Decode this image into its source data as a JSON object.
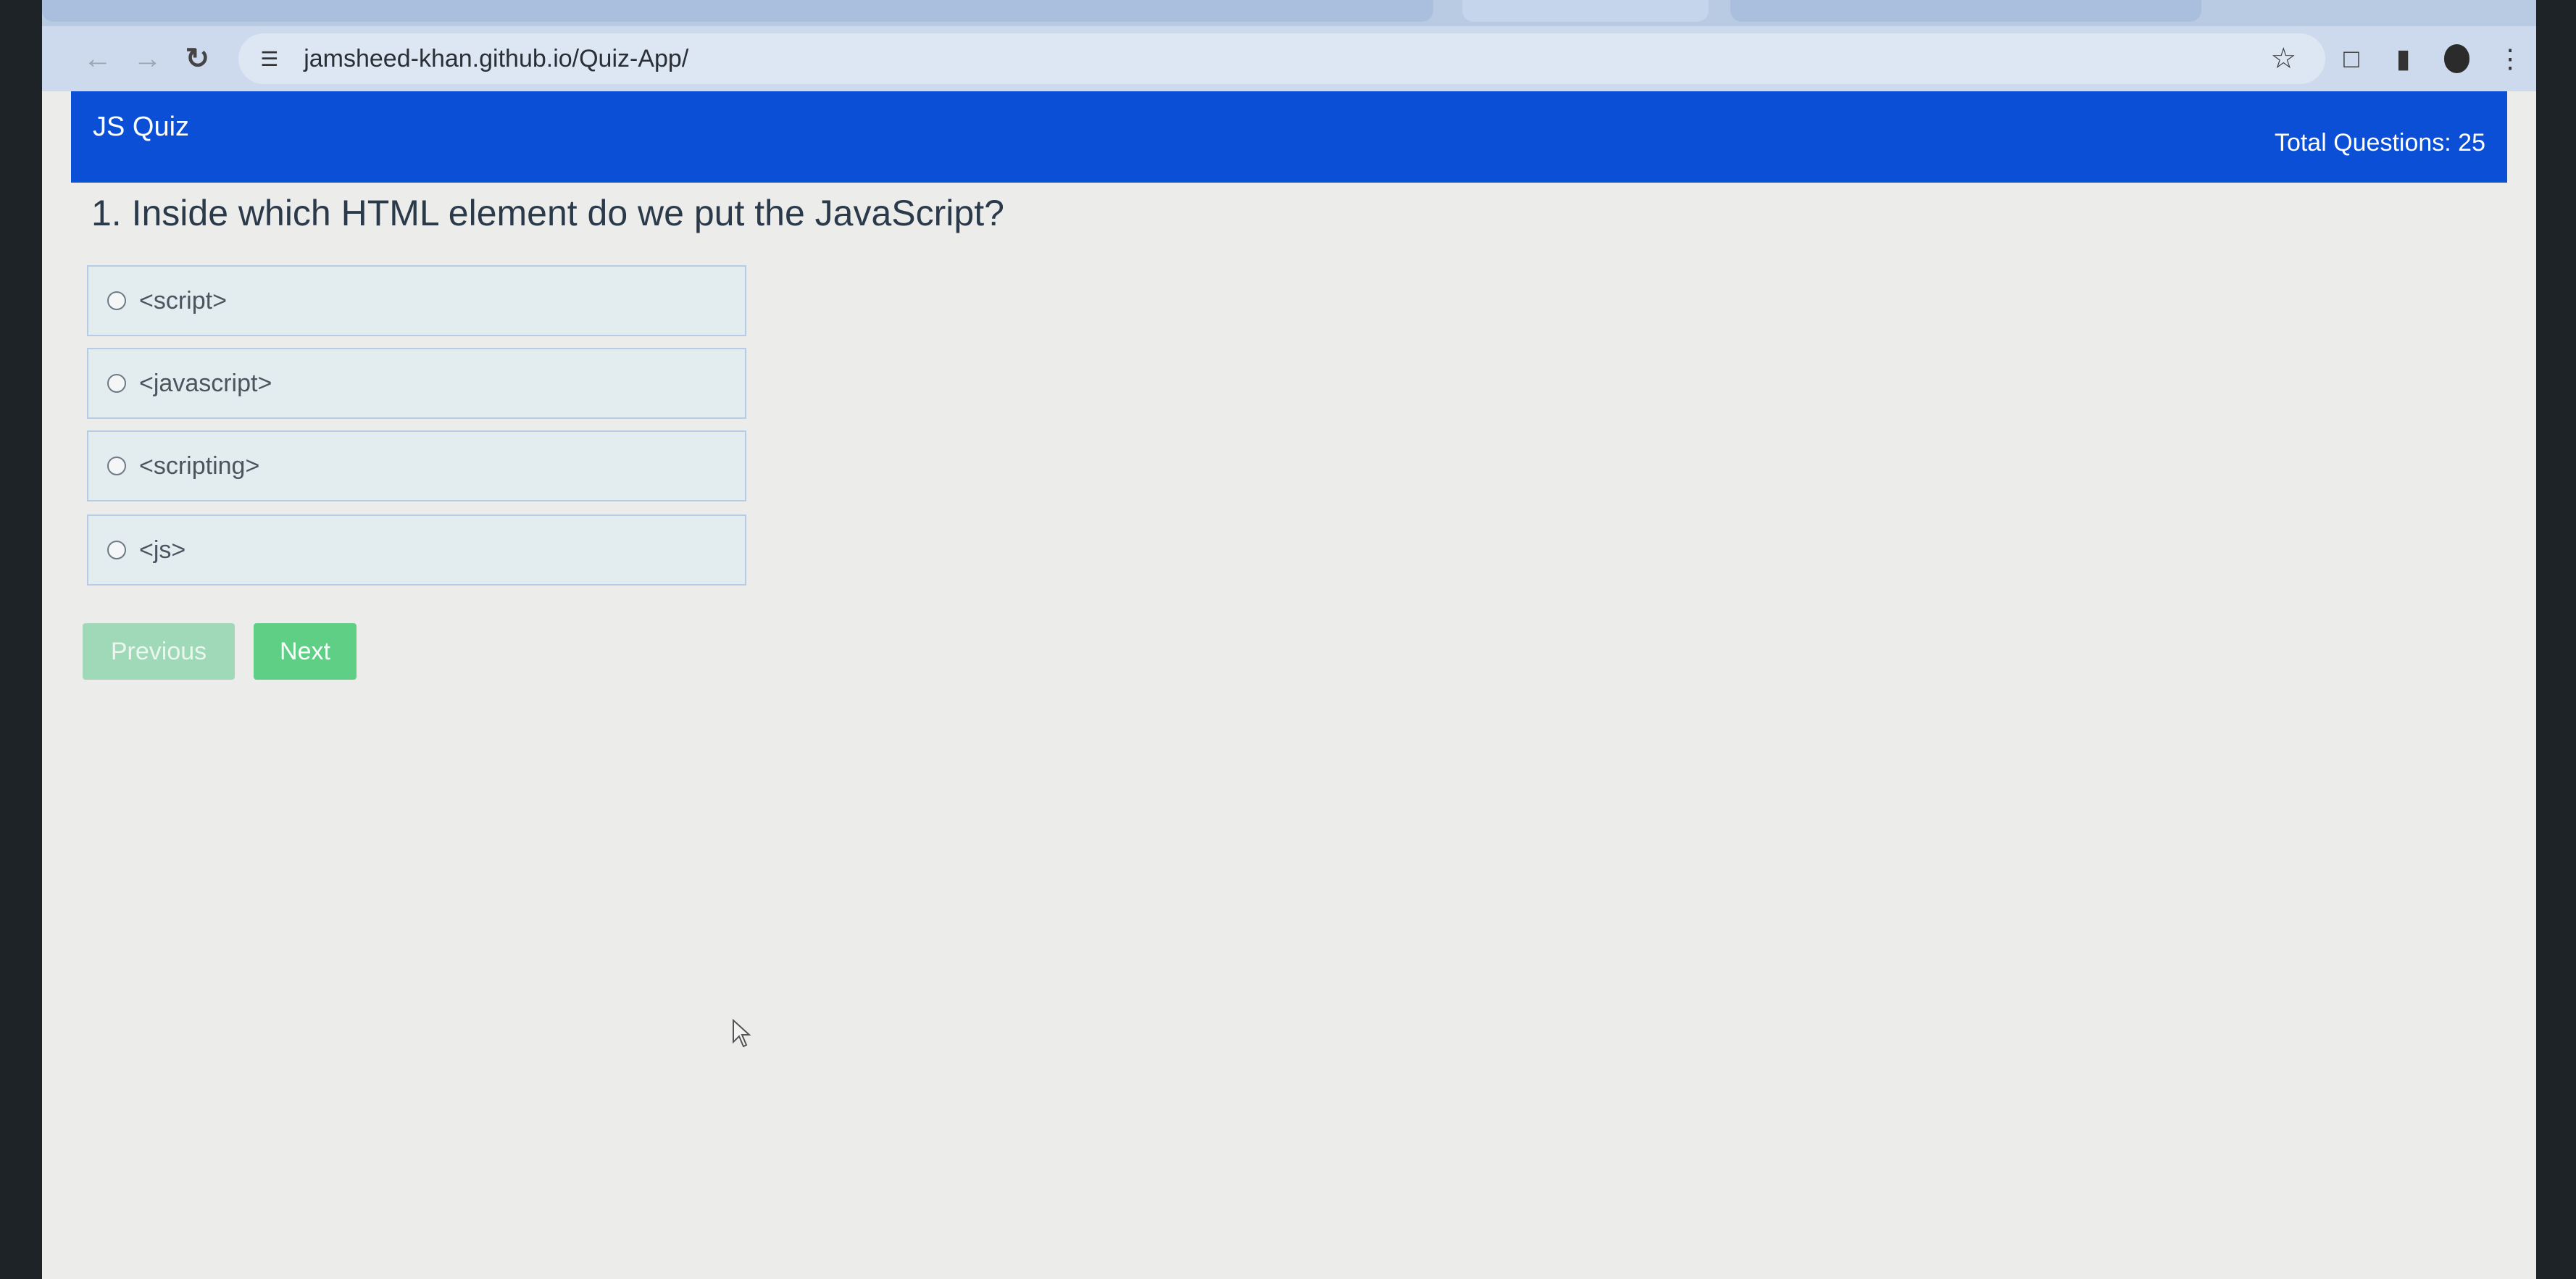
{
  "browser": {
    "url": "jamsheed-khan.github.io/Quiz-App/",
    "icons": [
      "back-arrow-icon",
      "forward-arrow-icon",
      "reload-icon",
      "site-settings-icon",
      "star-icon",
      "extensions-icon",
      "side-panel-icon",
      "profile-avatar",
      "menu-kebab-icon"
    ]
  },
  "navbar": {
    "brand": "JS Quiz",
    "total_questions": "Total Questions: 25",
    "color": "#0a4fd6"
  },
  "quiz": {
    "question": "1. Inside which HTML element do we put the JavaScript?",
    "options": [
      "<script>",
      "<javascript>",
      "<scripting>",
      "<js>"
    ]
  },
  "buttons": {
    "previous": "Previous",
    "next": "Next",
    "color": "#5fcf86"
  }
}
